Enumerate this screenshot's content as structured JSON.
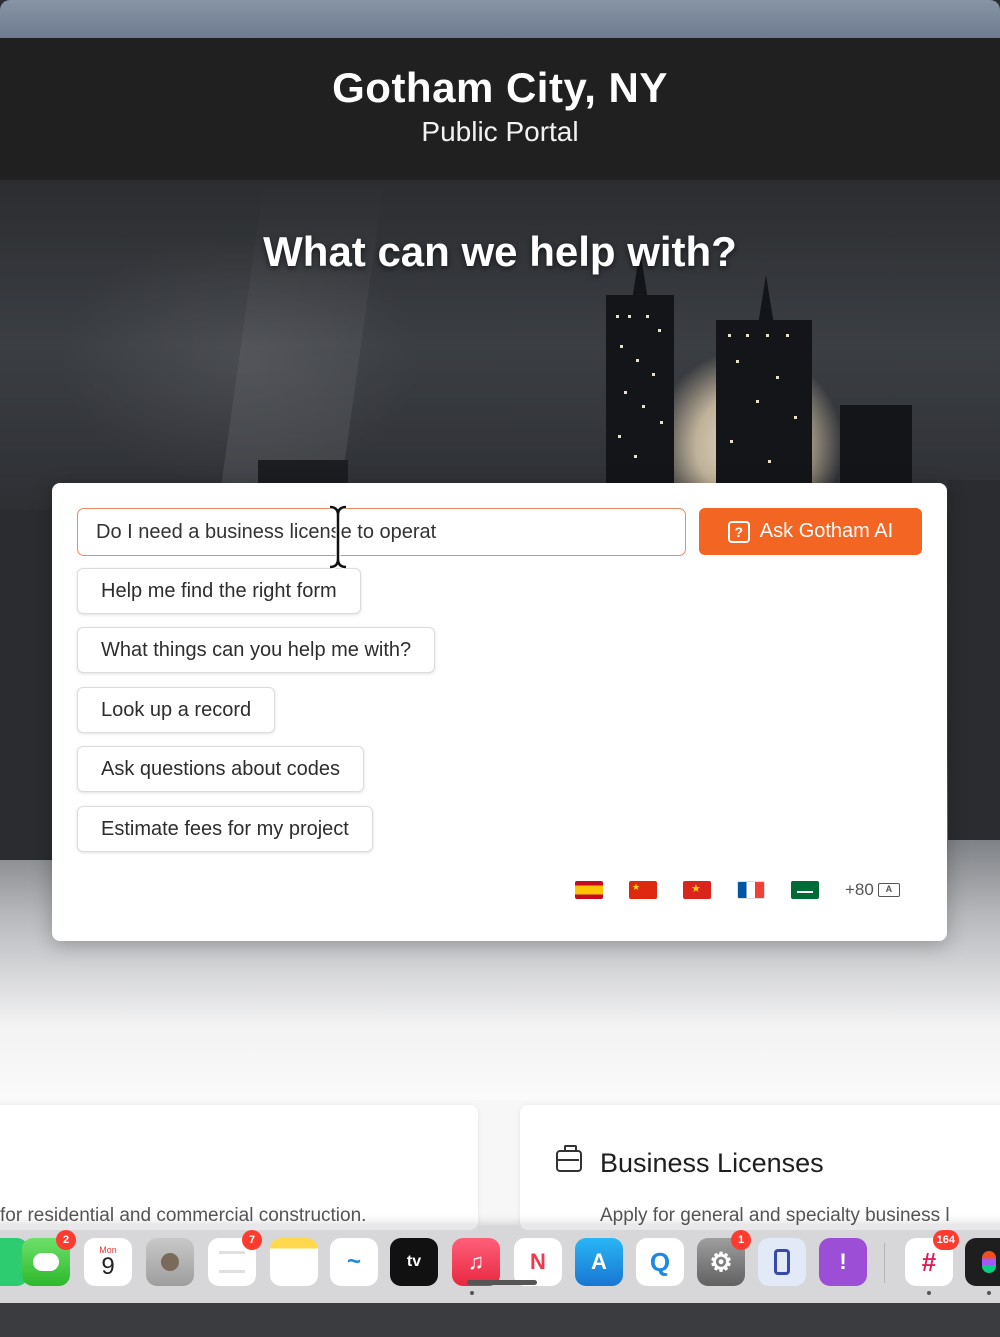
{
  "header": {
    "city": "Gotham City, NY",
    "portal": "Public Portal"
  },
  "hero": {
    "title": "What can we help with?"
  },
  "search": {
    "value": "Do I need a business license to operat",
    "button_label": "Ask Gotham AI",
    "button_icon": "ai-chat-icon"
  },
  "suggestions": [
    "Help me find the right form",
    "What things can you help me with?",
    "Look up a record",
    "Ask questions about codes",
    "Estimate fees for my project"
  ],
  "languages": {
    "flags": [
      "spain-flag",
      "china-flag",
      "vietnam-flag",
      "france-flag",
      "saudi-arabia-flag"
    ],
    "more_label": "+80"
  },
  "services": {
    "left_desc": "for residential and commercial construction.",
    "right_title": "Business Licenses",
    "right_desc": "Apply for general and specialty business l"
  },
  "dock": {
    "calendar_month": "Mon",
    "calendar_day": "9",
    "badges": {
      "messages": "2",
      "reminders": "7",
      "settings": "1",
      "slack": "164"
    }
  },
  "colors": {
    "accent": "#f26522",
    "input_border": "#ee8a63",
    "header_bg": "#202020"
  }
}
